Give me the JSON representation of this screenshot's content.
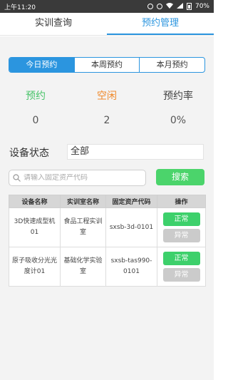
{
  "status_bar": {
    "time": "上午11:20",
    "battery": "70%"
  },
  "tabs": [
    {
      "label": "实训查询",
      "active": false
    },
    {
      "label": "预约管理",
      "active": true
    }
  ],
  "period_segments": [
    {
      "label": "今日预约",
      "active": true
    },
    {
      "label": "本周预约",
      "active": false
    },
    {
      "label": "本月预约",
      "active": false
    }
  ],
  "stats": [
    {
      "label": "预约",
      "value": "0",
      "color": "#49c46a"
    },
    {
      "label": "空闲",
      "value": "2",
      "color": "#f08a2c"
    },
    {
      "label": "预约率",
      "value": "0%",
      "color": "#444444"
    }
  ],
  "filter": {
    "label": "设备状态",
    "value": "全部"
  },
  "search": {
    "placeholder": "请输入固定资产代码",
    "button_label": "搜索"
  },
  "table": {
    "headers": [
      "设备名称",
      "实训室名称",
      "固定资产代码",
      "操作"
    ],
    "rows": [
      {
        "device": "3D快速成型机01",
        "room": "食品工程实训室",
        "code": "sxsb-3d-0101",
        "normal_label": "正常",
        "abnormal_label": "异常"
      },
      {
        "device": "原子吸收分光光度计01",
        "room": "基础化学实验室",
        "code": "sxsb-tas990-0101",
        "normal_label": "正常",
        "abnormal_label": "异常"
      }
    ]
  },
  "colors": {
    "accent": "#2b95df",
    "green": "#3dd06b",
    "orange": "#f08a2c",
    "gray_button": "#cbcbcb"
  }
}
